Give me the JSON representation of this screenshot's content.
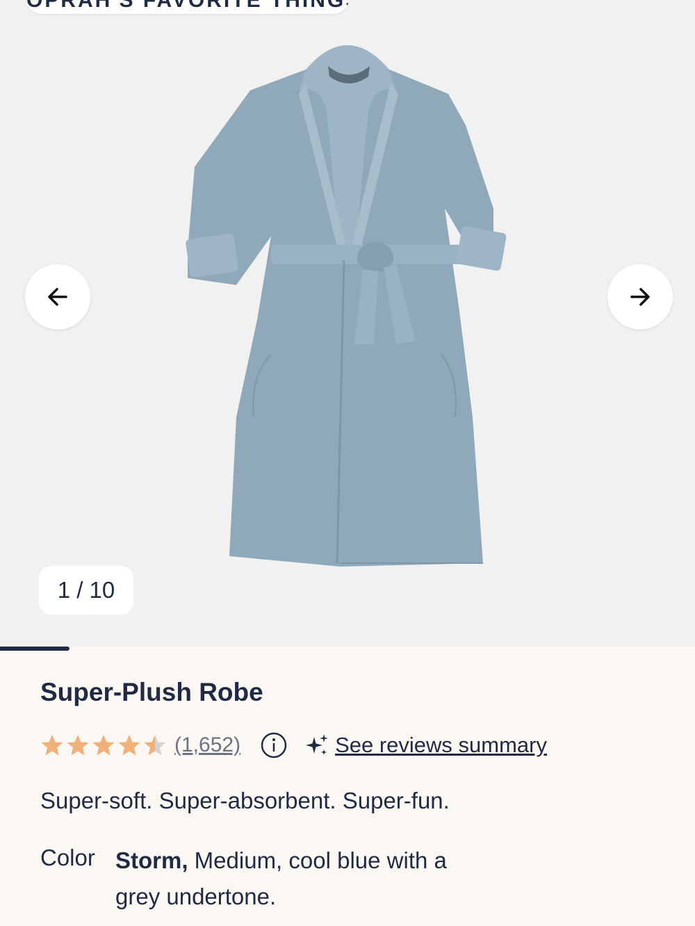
{
  "gallery": {
    "top_badge": "OPRAH'S FAVORITE THINGS",
    "counter": "1 / 10",
    "current_image": 1,
    "total_images": 10,
    "progress_fraction": 0.1,
    "prev_icon": "arrow-left-icon",
    "next_icon": "arrow-right-icon"
  },
  "product": {
    "title": "Super-Plush Robe",
    "rating": 4.5,
    "rating_max": 5,
    "review_count": "(1,652)",
    "summary_link": "See reviews summary",
    "tagline": "Super-soft. Super-absorbent. Super-fun.",
    "color_label": "Color",
    "color_name": "Storm,",
    "color_description": " Medium, cool blue with a grey undertone."
  },
  "colors": {
    "star": "#f0b07a",
    "star_empty": "#d4d4d4",
    "text": "#1f2a44",
    "robe": "#8fa9bb"
  }
}
